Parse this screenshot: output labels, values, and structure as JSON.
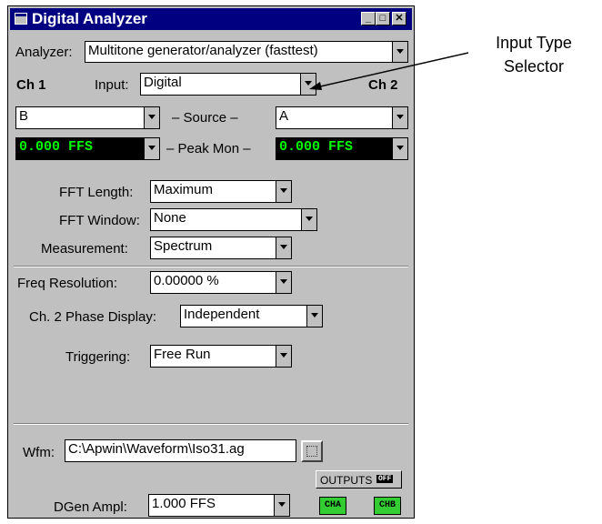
{
  "window": {
    "title": "Digital Analyzer"
  },
  "titlebar_buttons": {
    "minimize": "_",
    "maximize": "□",
    "close": "✕"
  },
  "analyzer": {
    "label": "Analyzer:",
    "value": "Multitone generator/analyzer (fasttest)"
  },
  "channels": {
    "ch1": "Ch 1",
    "ch2": "Ch 2"
  },
  "input": {
    "label": "Input:",
    "value": "Digital"
  },
  "source": {
    "label": "– Source –",
    "ch1": "B",
    "ch2": "A"
  },
  "peak_mon": {
    "label": "– Peak Mon –",
    "ch1": "0.000   FFS",
    "ch2": "0.000   FFS"
  },
  "fft_length": {
    "label": "FFT Length:",
    "value": "Maximum"
  },
  "fft_window": {
    "label": "FFT Window:",
    "value": "None"
  },
  "measurement": {
    "label": "Measurement:",
    "value": "Spectrum"
  },
  "freq_resolution": {
    "label": "Freq Resolution:",
    "value": "0.00000  %"
  },
  "phase_display": {
    "label": "Ch. 2 Phase Display:",
    "value": "Independent"
  },
  "triggering": {
    "label": "Triggering:",
    "value": "Free Run"
  },
  "wfm": {
    "label": "Wfm:",
    "value": "C:\\Apwin\\Waveform\\Iso31.ag"
  },
  "outputs": {
    "label": "OUTPUTS",
    "state": "OFF",
    "cha": "CHA",
    "chb": "CHB"
  },
  "dgen": {
    "label": "DGen Ampl:",
    "value": "1.000   FFS"
  },
  "callout": {
    "line1": "Input Type",
    "line2": "Selector"
  }
}
